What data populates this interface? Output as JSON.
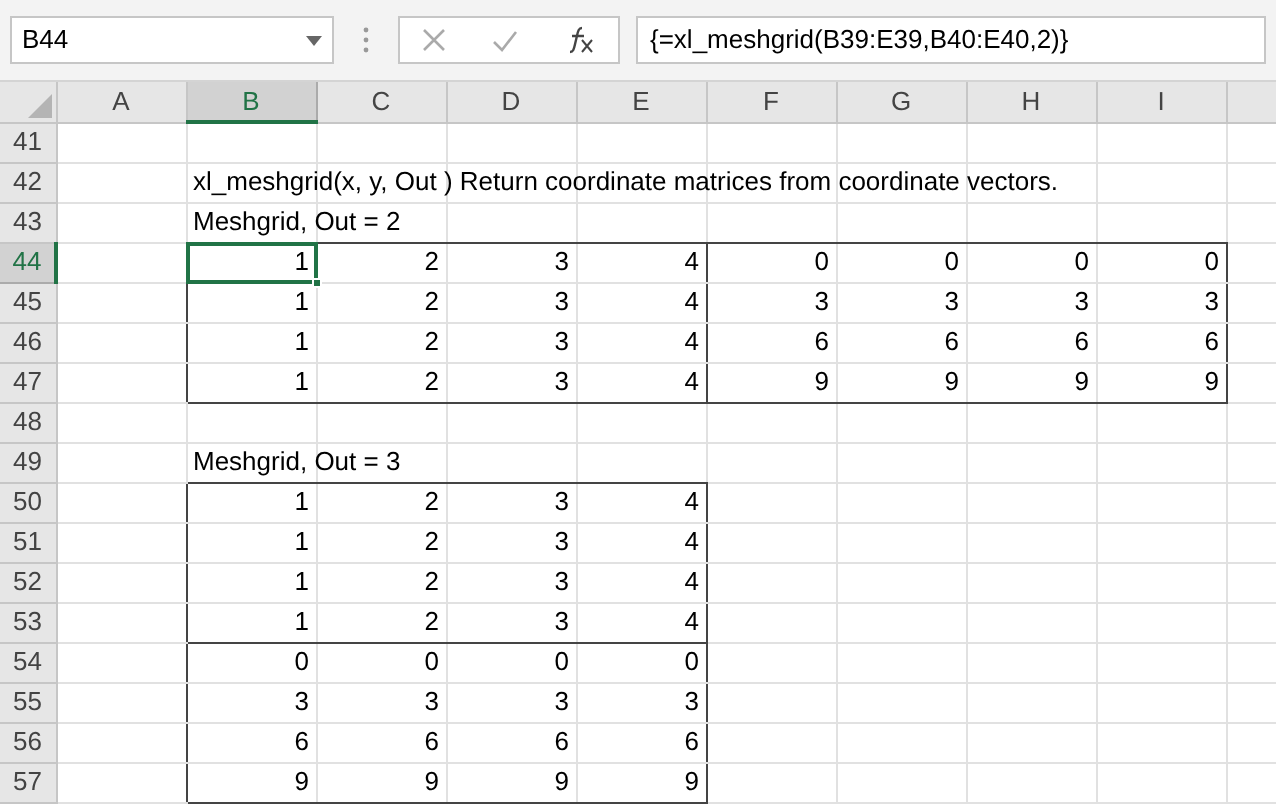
{
  "name_box": "B44",
  "formula": "{=xl_meshgrid(B39:E39,B40:E40,2)}",
  "columns": [
    {
      "label": "A",
      "selected": false
    },
    {
      "label": "B",
      "selected": true
    },
    {
      "label": "C",
      "selected": false
    },
    {
      "label": "D",
      "selected": false
    },
    {
      "label": "E",
      "selected": false
    },
    {
      "label": "F",
      "selected": false
    },
    {
      "label": "G",
      "selected": false
    },
    {
      "label": "H",
      "selected": false
    },
    {
      "label": "I",
      "selected": false
    }
  ],
  "row_headers": [
    {
      "label": "41",
      "selected": false
    },
    {
      "label": "42",
      "selected": false
    },
    {
      "label": "43",
      "selected": false
    },
    {
      "label": "44",
      "selected": true
    },
    {
      "label": "45",
      "selected": false
    },
    {
      "label": "46",
      "selected": false
    },
    {
      "label": "47",
      "selected": false
    },
    {
      "label": "48",
      "selected": false
    },
    {
      "label": "49",
      "selected": false
    },
    {
      "label": "50",
      "selected": false
    },
    {
      "label": "51",
      "selected": false
    },
    {
      "label": "52",
      "selected": false
    },
    {
      "label": "53",
      "selected": false
    },
    {
      "label": "54",
      "selected": false
    },
    {
      "label": "55",
      "selected": false
    },
    {
      "label": "56",
      "selected": false
    },
    {
      "label": "57",
      "selected": false
    }
  ],
  "note": "xl_meshgrid(x, y, Out ) Return coordinate matrices from coordinate vectors.",
  "meshgrid_out2": {
    "label": "Meshgrid, Out = 2",
    "blocks": [
      [
        [
          {
            "v": "1",
            "selected": true
          },
          {
            "v": "2",
            "selected": false
          },
          {
            "v": "3",
            "selected": false
          },
          {
            "v": "4",
            "selected": false
          }
        ],
        [
          {
            "v": "1",
            "selected": false
          },
          {
            "v": "2",
            "selected": false
          },
          {
            "v": "3",
            "selected": false
          },
          {
            "v": "4",
            "selected": false
          }
        ],
        [
          {
            "v": "1",
            "selected": false
          },
          {
            "v": "2",
            "selected": false
          },
          {
            "v": "3",
            "selected": false
          },
          {
            "v": "4",
            "selected": false
          }
        ],
        [
          {
            "v": "1",
            "selected": false
          },
          {
            "v": "2",
            "selected": false
          },
          {
            "v": "3",
            "selected": false
          },
          {
            "v": "4",
            "selected": false
          }
        ]
      ],
      [
        [
          {
            "v": "0",
            "selected": false
          },
          {
            "v": "0",
            "selected": false
          },
          {
            "v": "0",
            "selected": false
          },
          {
            "v": "0",
            "selected": false
          }
        ],
        [
          {
            "v": "3",
            "selected": false
          },
          {
            "v": "3",
            "selected": false
          },
          {
            "v": "3",
            "selected": false
          },
          {
            "v": "3",
            "selected": false
          }
        ],
        [
          {
            "v": "6",
            "selected": false
          },
          {
            "v": "6",
            "selected": false
          },
          {
            "v": "6",
            "selected": false
          },
          {
            "v": "6",
            "selected": false
          }
        ],
        [
          {
            "v": "9",
            "selected": false
          },
          {
            "v": "9",
            "selected": false
          },
          {
            "v": "9",
            "selected": false
          },
          {
            "v": "9",
            "selected": false
          }
        ]
      ]
    ]
  },
  "meshgrid_out3": {
    "label": "Meshgrid, Out = 3",
    "blocks": [
      [
        [
          {
            "v": "1",
            "selected": false
          },
          {
            "v": "2",
            "selected": false
          },
          {
            "v": "3",
            "selected": false
          },
          {
            "v": "4",
            "selected": false
          }
        ],
        [
          {
            "v": "1",
            "selected": false
          },
          {
            "v": "2",
            "selected": false
          },
          {
            "v": "3",
            "selected": false
          },
          {
            "v": "4",
            "selected": false
          }
        ],
        [
          {
            "v": "1",
            "selected": false
          },
          {
            "v": "2",
            "selected": false
          },
          {
            "v": "3",
            "selected": false
          },
          {
            "v": "4",
            "selected": false
          }
        ],
        [
          {
            "v": "1",
            "selected": false
          },
          {
            "v": "2",
            "selected": false
          },
          {
            "v": "3",
            "selected": false
          },
          {
            "v": "4",
            "selected": false
          }
        ]
      ],
      [
        [
          {
            "v": "0",
            "selected": false
          },
          {
            "v": "0",
            "selected": false
          },
          {
            "v": "0",
            "selected": false
          },
          {
            "v": "0",
            "selected": false
          }
        ],
        [
          {
            "v": "3",
            "selected": false
          },
          {
            "v": "3",
            "selected": false
          },
          {
            "v": "3",
            "selected": false
          },
          {
            "v": "3",
            "selected": false
          }
        ],
        [
          {
            "v": "6",
            "selected": false
          },
          {
            "v": "6",
            "selected": false
          },
          {
            "v": "6",
            "selected": false
          },
          {
            "v": "6",
            "selected": false
          }
        ],
        [
          {
            "v": "9",
            "selected": false
          },
          {
            "v": "9",
            "selected": false
          },
          {
            "v": "9",
            "selected": false
          },
          {
            "v": "9",
            "selected": false
          }
        ]
      ]
    ]
  }
}
